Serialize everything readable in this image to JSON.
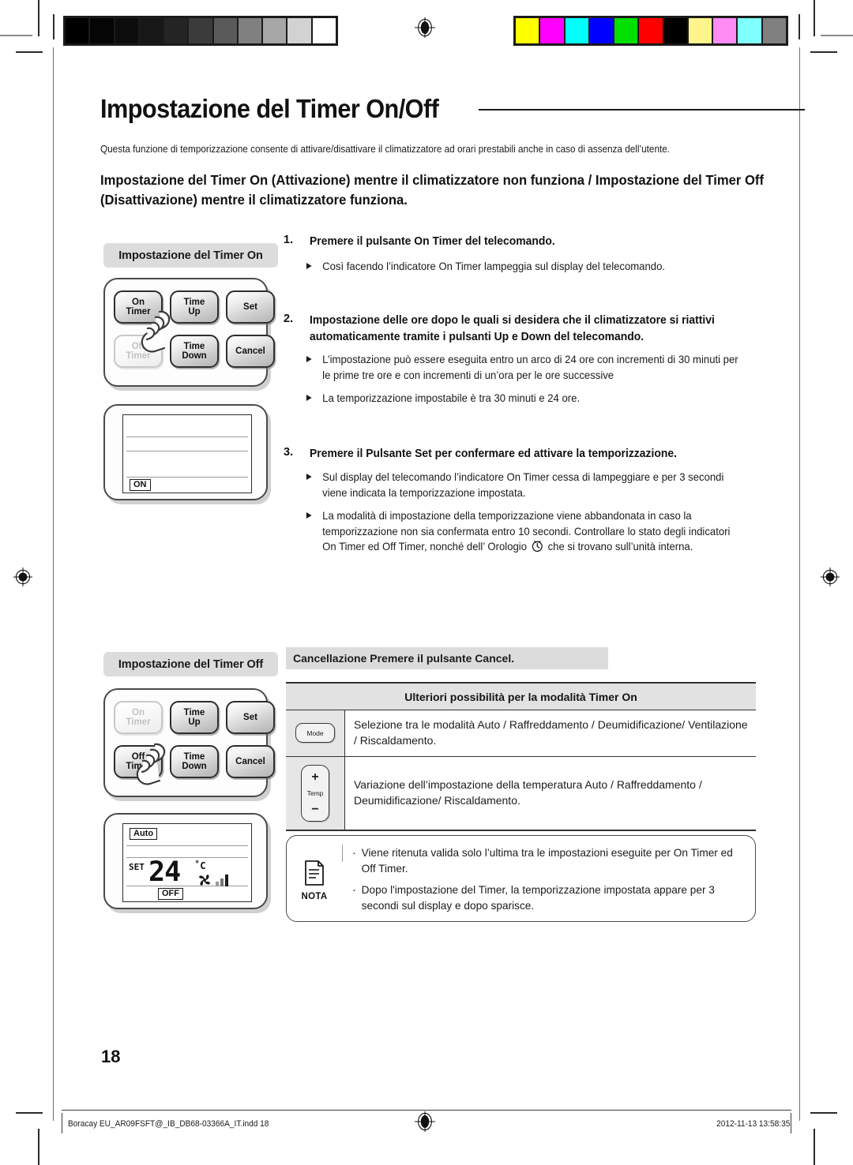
{
  "document": {
    "title": "Impostazione del Timer On/Off",
    "intro": "Questa funzione di temporizzazione consente di attivare/disattivare il climatizzatore ad orari prestabili anche in caso di assenza dell’utente.",
    "subtitle": "Impostazione del Timer On (Attivazione) mentre il climatizzatore non funziona / Impostazione del Timer Off (Disattivazione) mentre il climatizzatore  funziona.",
    "page_number": "18"
  },
  "calibration": {
    "grayscale": [
      "#000000",
      "#050505",
      "#0d0d0d",
      "#171717",
      "#242424",
      "#3b3b3b",
      "#5a5a5a",
      "#808080",
      "#a6a6a6",
      "#d2d2d2",
      "#ffffff"
    ],
    "colors": [
      "#ffff00",
      "#ff00ff",
      "#00ffff",
      "#0000ff",
      "#00e000",
      "#ff0000",
      "#000000",
      "#fff58a",
      "#ff8cf5",
      "#80ffff",
      "#808080"
    ]
  },
  "timer_on_panel": {
    "label": "Impostazione del Timer On",
    "buttons": [
      {
        "line1": "On",
        "line2": "Timer",
        "state": "active"
      },
      {
        "line1": "Time",
        "line2": "Up",
        "state": "active"
      },
      {
        "line1": "Set",
        "line2": "",
        "state": "active"
      },
      {
        "line1": "Off",
        "line2": "Timer",
        "state": "dim"
      },
      {
        "line1": "Time",
        "line2": "Down",
        "state": "active"
      },
      {
        "line1": "Cancel",
        "line2": "",
        "state": "active"
      }
    ],
    "display": {
      "indicator": "ON"
    }
  },
  "timer_off_panel": {
    "label": "Impostazione del Timer Off",
    "buttons": [
      {
        "line1": "On",
        "line2": "Timer",
        "state": "dim"
      },
      {
        "line1": "Time",
        "line2": "Up",
        "state": "active"
      },
      {
        "line1": "Set",
        "line2": "",
        "state": "active"
      },
      {
        "line1": "Off",
        "line2": "Timer",
        "state": "active"
      },
      {
        "line1": "Time",
        "line2": "Down",
        "state": "active"
      },
      {
        "line1": "Cancel",
        "line2": "",
        "state": "active"
      }
    ],
    "display": {
      "mode": "Auto",
      "set_label": "SET",
      "temperature": "24",
      "unit": "˚C",
      "indicator": "OFF"
    }
  },
  "steps": [
    {
      "number": "1.",
      "text": "Premere il pulsante On Timer del telecomando.",
      "bullets": [
        "Così facendo l’indicatore On Timer  lampeggia sul display del telecomando."
      ]
    },
    {
      "number": "2.",
      "text": "Impostazione delle ore dopo le quali  si desidera che il climatizzatore si riattivi automaticamente tramite i pulsanti Up e Down del telecomando.",
      "bullets": [
        "L’impostazione può essere eseguita entro un arco di 24 ore con incrementi di 30 minuti per le prime tre ore e con incrementi di un’ora per le ore successive",
        "La temporizzazione impostabile è tra 30 minuti e 24 ore."
      ]
    },
    {
      "number": "3.",
      "text": "Premere il Pulsante Set per confermare ed attivare  la temporizzazione.",
      "bullets": [
        "Sul display del telecomando l’indicatore On Timer cessa di lampeggiare e per 3 secondi viene indicata la temporizzazione impostata."
      ],
      "bullet_with_icon": {
        "part1": "La modalità di impostazione della temporizzazione viene abbandonata in caso la temporizzazione non sia confermata entro 10 secondi.  Controllare lo stato degli indicatori On Timer ed Off Timer, nonché dell’ Orologio",
        "icon": "clock-icon",
        "part2": "che si trovano sull’unità interna."
      }
    }
  ],
  "cancel_bar": {
    "text": "Cancellazione  Premere il pulsante Cancel."
  },
  "options_table": {
    "header": "Ulteriori possibilità  per la modalità Timer On",
    "rows": [
      {
        "icon_label": "Mode",
        "icon_type": "mode-button",
        "text": "Selezione tra le modalità Auto / Raffreddamento / Deumidificazione/ Ventilazione  / Riscaldamento."
      },
      {
        "icon_label": "Temp",
        "icon_type": "temp-button",
        "icon_plus": "+",
        "icon_minus": "−",
        "text": "Variazione dell’impostazione della temperatura Auto / Raffreddamento / Deumidificazione/ Riscaldamento."
      }
    ]
  },
  "nota": {
    "label": "NOTA",
    "bullets": [
      "Viene ritenuta valida solo  l’ultima tra le impostazioni eseguite per  On Timer ed Off Timer.",
      "Dopo l'impostazione del Timer, la temporizzazione impostata appare per 3 secondi sul display e dopo sparisce."
    ]
  },
  "footer": {
    "left": "Boracay EU_AR09FSFT@_IB_DB68-03366A_IT.indd   18",
    "right": "2012-11-13   13:58:35"
  }
}
